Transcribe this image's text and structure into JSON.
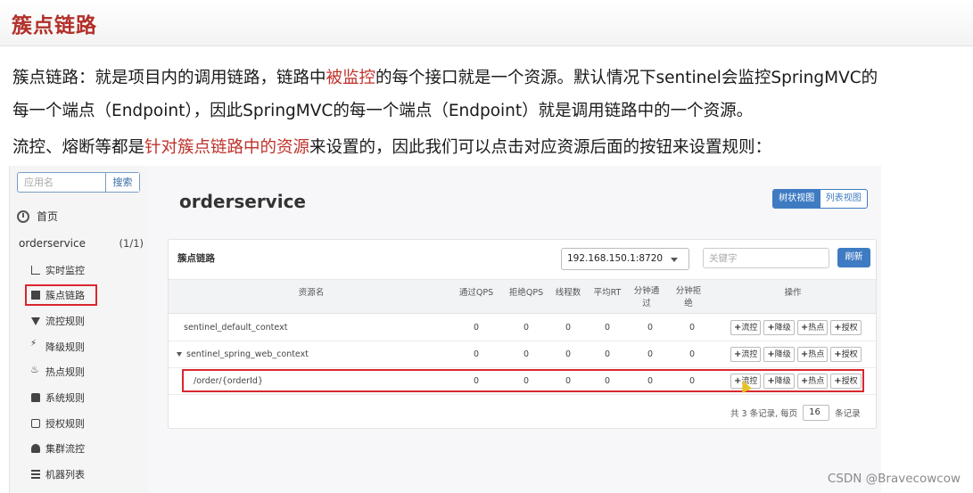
{
  "slide": {
    "title": "簇点链路",
    "p1_a": "簇点链路：就是项目内的调用链路，链路中",
    "p1_hl": "被监控",
    "p1_b": "的每个接口就是一个资源。默认情况下sentinel会监控SpringMVC的",
    "p2": "每一个端点（Endpoint），因此SpringMVC的每一个端点（Endpoint）就是调用链路中的一个资源。",
    "p3_a": "流控、熔断等都是",
    "p3_hl": "针对簇点链路中的资源",
    "p3_b": "来设置的，因此我们可以点击对应资源后面的按钮来设置规则："
  },
  "sidebar": {
    "search_placeholder": "应用名",
    "search_button": "搜索",
    "home": "首页",
    "app_name": "orderservice",
    "app_count": "(1/1)",
    "items": [
      {
        "label": "实时监控",
        "icon": "bar-chart-icon"
      },
      {
        "label": "簇点链路",
        "icon": "document-icon"
      },
      {
        "label": "流控规则",
        "icon": "filter-icon"
      },
      {
        "label": "降级规则",
        "icon": "bolt-icon"
      },
      {
        "label": "热点规则",
        "icon": "fire-icon"
      },
      {
        "label": "系统规则",
        "icon": "lock-icon"
      },
      {
        "label": "授权规则",
        "icon": "check-icon"
      },
      {
        "label": "集群流控",
        "icon": "cloud-icon"
      },
      {
        "label": "机器列表",
        "icon": "list-icon"
      }
    ]
  },
  "main": {
    "title": "orderservice",
    "view_tree": "树状视图",
    "view_list": "列表视图",
    "card_title": "簇点链路",
    "machine": "192.168.150.1:8720",
    "keyword_placeholder": "关键字",
    "refresh": "刷新",
    "columns": {
      "resource": "资源名",
      "pass_qps": "通过QPS",
      "block_qps": "拒绝QPS",
      "threads": "线程数",
      "avg_rt": "平均RT",
      "minute_pass": "分钟通过",
      "minute_block": "分钟拒绝",
      "ops": "操作"
    },
    "actions": {
      "flow": "流控",
      "degrade": "降级",
      "hot": "热点",
      "auth": "授权"
    },
    "rows": [
      {
        "name": "sentinel_default_context",
        "pass_qps": "0",
        "block_qps": "0",
        "threads": "0",
        "avg_rt": "0",
        "minute_pass": "0",
        "minute_block": "0"
      },
      {
        "name": "sentinel_spring_web_context",
        "pass_qps": "0",
        "block_qps": "0",
        "threads": "0",
        "avg_rt": "0",
        "minute_pass": "0",
        "minute_block": "0"
      },
      {
        "name": "/order/{orderId}",
        "pass_qps": "0",
        "block_qps": "0",
        "threads": "0",
        "avg_rt": "0",
        "minute_pass": "0",
        "minute_block": "0"
      }
    ],
    "pager_prefix": "共 3 条记录, 每页",
    "page_size": "16",
    "pager_suffix": "条记录"
  },
  "watermark": "CSDN @Bravecowcow",
  "colors": {
    "accent_red": "#c0322b",
    "primary_blue": "#3f7bc2",
    "highlight_box": "#d9272e"
  }
}
